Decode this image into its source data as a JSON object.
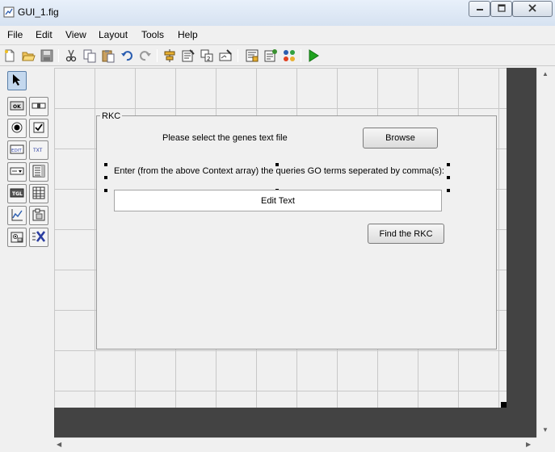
{
  "window": {
    "title": "GUI_1.fig"
  },
  "menubar": {
    "items": [
      "File",
      "Edit",
      "View",
      "Layout",
      "Tools",
      "Help"
    ]
  },
  "toolbar": {
    "icons": [
      "new-file-icon",
      "open-folder-icon",
      "save-icon",
      "cut-icon",
      "copy-icon",
      "paste-icon",
      "undo-icon",
      "redo-icon",
      "align-objects-icon",
      "menu-editor-icon",
      "tab-order-icon",
      "toolbar-editor-icon",
      "editor-icon",
      "property-inspector-icon",
      "object-browser-icon",
      "run-icon"
    ]
  },
  "palette": {
    "tools": [
      {
        "name": "select-tool",
        "text": ""
      },
      {
        "name": "push-button-tool",
        "text": "OK"
      },
      {
        "name": "slider-tool",
        "text": ""
      },
      {
        "name": "radio-button-tool",
        "text": ""
      },
      {
        "name": "checkbox-tool",
        "text": ""
      },
      {
        "name": "edit-text-tool",
        "text": "EDIT"
      },
      {
        "name": "static-text-tool",
        "text": "TXT"
      },
      {
        "name": "popup-menu-tool",
        "text": ""
      },
      {
        "name": "listbox-tool",
        "text": ""
      },
      {
        "name": "toggle-button-tool",
        "text": "TGL"
      },
      {
        "name": "table-tool",
        "text": ""
      },
      {
        "name": "axes-tool",
        "text": ""
      },
      {
        "name": "panel-tool",
        "text": ""
      },
      {
        "name": "button-group-tool",
        "text": ""
      },
      {
        "name": "activex-tool",
        "text": ""
      }
    ]
  },
  "panel": {
    "title": "RKC",
    "select_label": "Please select the genes text file",
    "browse_label": "Browse",
    "query_label": "Enter (from the above Context array) the queries GO terms seperated by comma(s):",
    "edit_text": "Edit Text",
    "find_label": "Find the RKC"
  }
}
